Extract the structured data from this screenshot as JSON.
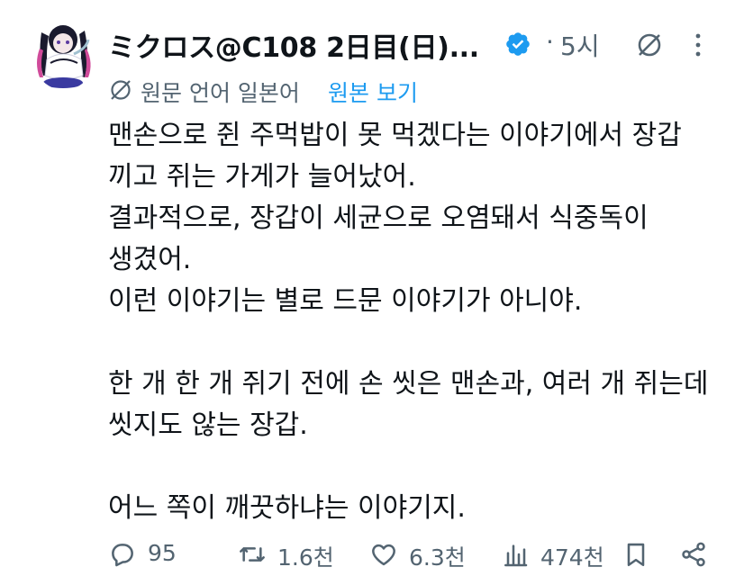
{
  "author": {
    "display_name": "ミクロス@C108 2日目(日)...",
    "verified": true,
    "separator": "·",
    "timestamp": "5시"
  },
  "translation": {
    "note": "원문 언어 일본어",
    "show_original_label": "원본 보기"
  },
  "tweet": {
    "lines": [
      "맨손으로 쥔 주먹밥이 못 먹겠다는 이야기에서 장갑",
      "끼고 쥐는 가게가 늘어났어.",
      "결과적으로, 장갑이 세균으로 오염돼서 식중독이",
      "생겼어.",
      "이런 이야기는 별로 드문 이야기가 아니야.",
      "",
      "한 개 한 개 쥐기 전에 손 씻은 맨손과, 여러 개 쥐는데",
      "씻지도 않는 장갑.",
      "",
      "어느 쪽이 깨끗하냐는 이야기지."
    ]
  },
  "actions": {
    "replies": "95",
    "reposts": "1.6천",
    "likes": "6.3천",
    "views": "474천"
  },
  "colors": {
    "text": "#0f1419",
    "secondary": "#536471",
    "accent": "#1d9bf0"
  },
  "icons": [
    "avatar",
    "verified-badge-icon",
    "grok-icon",
    "more-icon",
    "translate-icon",
    "reply-icon",
    "repost-icon",
    "like-icon",
    "views-icon",
    "bookmark-icon",
    "share-icon"
  ]
}
